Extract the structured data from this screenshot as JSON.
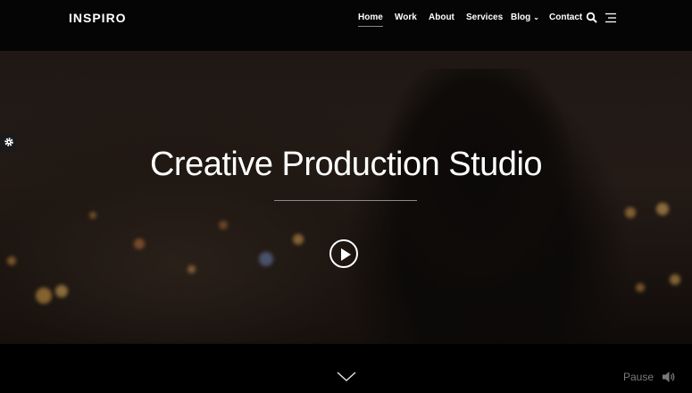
{
  "header": {
    "logo": "INSPIRO",
    "nav": [
      {
        "label": "Home",
        "active": true
      },
      {
        "label": "Work"
      },
      {
        "label": "About"
      },
      {
        "label": "Services"
      },
      {
        "label": "Blog",
        "dropdown": true
      },
      {
        "label": "Contact"
      }
    ],
    "search_icon": "search-icon",
    "menu_icon": "hamburger-menu-icon"
  },
  "hero": {
    "title": "Creative Production Studio",
    "play_icon": "play-icon",
    "settings_icon": "gear-icon"
  },
  "footer": {
    "scroll_icon": "chevron-down-icon",
    "pause_label": "Pause",
    "sound_icon": "speaker-icon"
  },
  "colors": {
    "background": "#000000",
    "text": "#ffffff",
    "muted": "#7a7a7a"
  }
}
